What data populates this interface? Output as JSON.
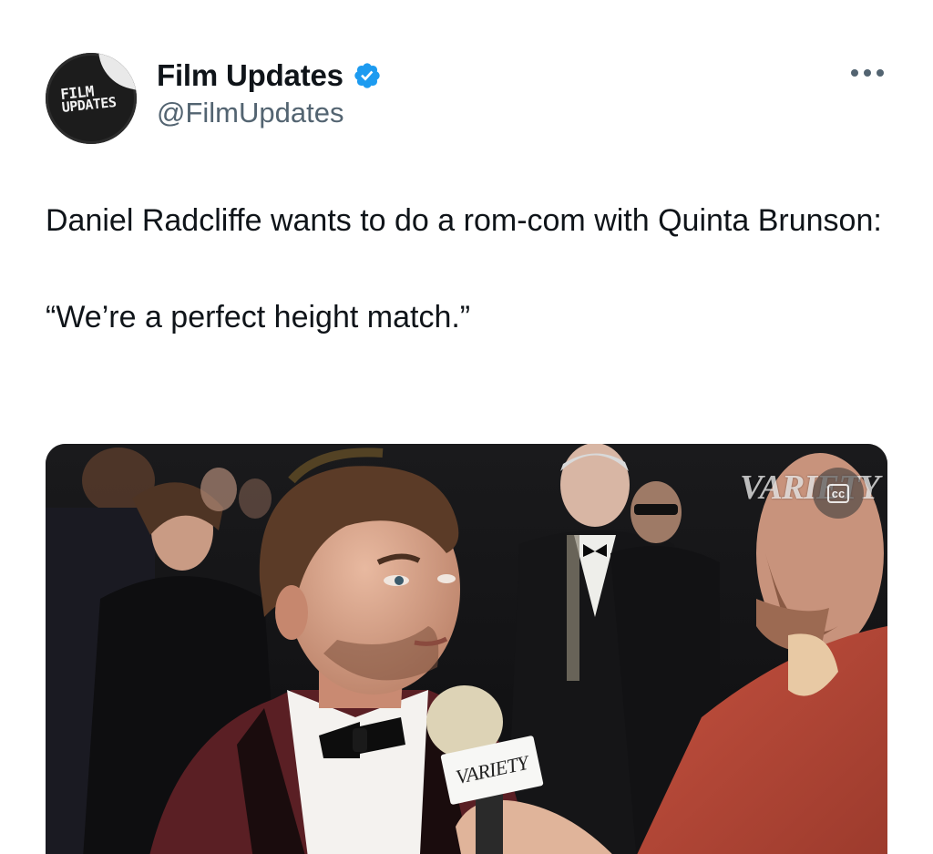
{
  "author": {
    "display_name": "Film Updates",
    "handle": "@FilmUpdates",
    "verified": true,
    "avatar_logo": {
      "line1": "FILM",
      "line2": "UPDATES"
    },
    "verified_color": "#1d9bf0"
  },
  "post": {
    "text_line1": "Daniel Radcliffe wants to do a rom-com with Quinta Brunson:",
    "text_line2": "“We’re a perfect height match.”"
  },
  "media": {
    "type": "video",
    "watermark": "VARIETY",
    "mic_flag": "VARIETY",
    "captions_button": "cc"
  },
  "icons": {
    "more": "more-horizontal-icon",
    "verified": "verified-badge-icon",
    "captions": "closed-captions-icon"
  },
  "colors": {
    "text": "#0f1419",
    "secondary_text": "#536471",
    "background": "#ffffff"
  }
}
